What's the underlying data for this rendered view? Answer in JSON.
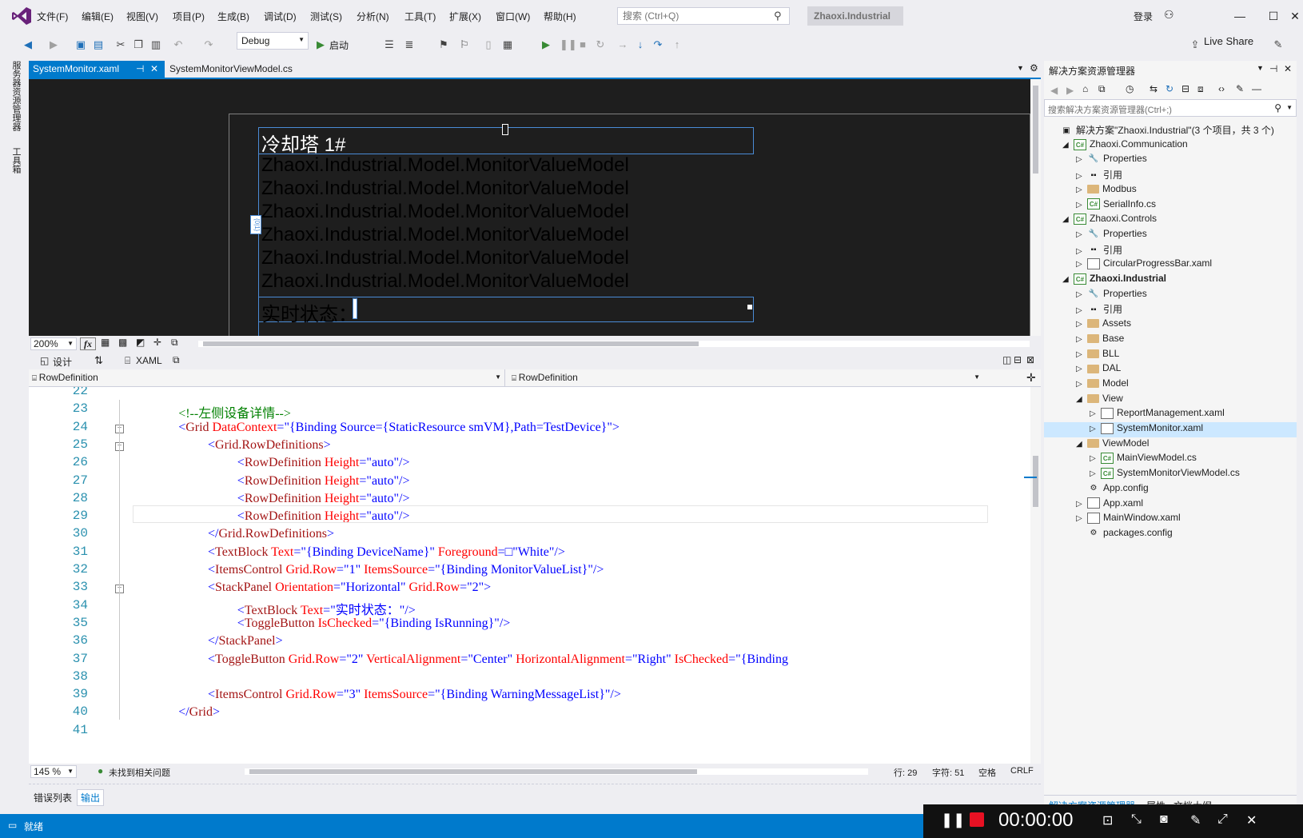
{
  "menu": [
    "文件(F)",
    "编辑(E)",
    "视图(V)",
    "项目(P)",
    "生成(B)",
    "调试(D)",
    "测试(S)",
    "分析(N)",
    "工具(T)",
    "扩展(X)",
    "窗口(W)",
    "帮助(H)"
  ],
  "search": {
    "placeholder": "搜索 (Ctrl+Q)"
  },
  "solution_badge": "Zhaoxi.Industrial",
  "login": "登录",
  "toolbar": {
    "config": "Debug",
    "start": "启动",
    "liveshare": "Live Share"
  },
  "left_tabs": [
    "服务器资源管理器",
    "工具箱"
  ],
  "tabs": [
    {
      "label": "SystemMonitor.xaml"
    },
    {
      "label": "SystemMonitorViewModel.cs"
    }
  ],
  "designer": {
    "title": "冷却塔 1#",
    "rows": [
      "Zhaoxi.Industrial.Model.MonitorValueModel",
      "Zhaoxi.Industrial.Model.MonitorValueModel",
      "Zhaoxi.Industrial.Model.MonitorValueModel",
      "Zhaoxi.Industrial.Model.MonitorValueModel",
      "Zhaoxi.Industrial.Model.MonitorValueModel",
      "Zhaoxi.Industrial.Model.MonitorValueModel"
    ],
    "status_label": "实时状态：",
    "adorner": "{0|1}",
    "zoom": "200%",
    "fx": "fx"
  },
  "split": {
    "design": "设计",
    "xaml": "XAML"
  },
  "nav": {
    "left": "RowDefinition",
    "right": "RowDefinition"
  },
  "code_lines": [
    {
      "n": "22",
      "indent": 0,
      "parts": []
    },
    {
      "n": "23",
      "indent": 6,
      "parts": [
        [
          "c",
          "<!--左侧设备详情-->"
        ]
      ]
    },
    {
      "n": "24",
      "indent": 6,
      "parts": [
        [
          "p",
          "<"
        ],
        [
          "t",
          "Grid"
        ],
        [
          "a",
          " DataContext"
        ],
        [
          "p",
          "=\""
        ],
        [
          "v",
          "{Binding Source={StaticResource smVM},Path=TestDevice}"
        ],
        [
          "p",
          "\">"
        ]
      ]
    },
    {
      "n": "25",
      "indent": 10,
      "parts": [
        [
          "p",
          "<"
        ],
        [
          "t",
          "Grid.RowDefinitions"
        ],
        [
          "p",
          ">"
        ]
      ]
    },
    {
      "n": "26",
      "indent": 14,
      "parts": [
        [
          "p",
          "<"
        ],
        [
          "t",
          "RowDefinition"
        ],
        [
          "a",
          " Height"
        ],
        [
          "p",
          "=\""
        ],
        [
          "v",
          "auto"
        ],
        [
          "p",
          "\"/>"
        ]
      ]
    },
    {
      "n": "27",
      "indent": 14,
      "parts": [
        [
          "p",
          "<"
        ],
        [
          "t",
          "RowDefinition"
        ],
        [
          "a",
          " Height"
        ],
        [
          "p",
          "=\""
        ],
        [
          "v",
          "auto"
        ],
        [
          "p",
          "\"/>"
        ]
      ]
    },
    {
      "n": "28",
      "indent": 14,
      "parts": [
        [
          "p",
          "<"
        ],
        [
          "t",
          "RowDefinition"
        ],
        [
          "a",
          " Height"
        ],
        [
          "p",
          "=\""
        ],
        [
          "v",
          "auto"
        ],
        [
          "p",
          "\"/>"
        ]
      ]
    },
    {
      "n": "29",
      "indent": 14,
      "parts": [
        [
          "p",
          "<"
        ],
        [
          "t",
          "RowDefinition"
        ],
        [
          "a",
          " Height"
        ],
        [
          "p",
          "=\""
        ],
        [
          "v",
          "auto"
        ],
        [
          "p",
          "\"/>"
        ]
      ]
    },
    {
      "n": "30",
      "indent": 10,
      "parts": [
        [
          "p",
          "</"
        ],
        [
          "t",
          "Grid.RowDefinitions"
        ],
        [
          "p",
          ">"
        ]
      ]
    },
    {
      "n": "31",
      "indent": 10,
      "parts": [
        [
          "p",
          "<"
        ],
        [
          "t",
          "TextBlock"
        ],
        [
          "a",
          " Text"
        ],
        [
          "p",
          "=\""
        ],
        [
          "v",
          "{Binding DeviceName}"
        ],
        [
          "p",
          "\""
        ],
        [
          "a",
          " Foreground"
        ],
        [
          "p",
          "=□\""
        ],
        [
          "v",
          "White"
        ],
        [
          "p",
          "\"/>"
        ]
      ]
    },
    {
      "n": "32",
      "indent": 10,
      "parts": [
        [
          "p",
          "<"
        ],
        [
          "t",
          "ItemsControl"
        ],
        [
          "a",
          " Grid.Row"
        ],
        [
          "p",
          "=\""
        ],
        [
          "v",
          "1"
        ],
        [
          "p",
          "\""
        ],
        [
          "a",
          " ItemsSource"
        ],
        [
          "p",
          "=\""
        ],
        [
          "v",
          "{Binding MonitorValueList}"
        ],
        [
          "p",
          "\"/>"
        ]
      ]
    },
    {
      "n": "33",
      "indent": 10,
      "parts": [
        [
          "p",
          "<"
        ],
        [
          "t",
          "StackPanel"
        ],
        [
          "a",
          " Orientation"
        ],
        [
          "p",
          "=\""
        ],
        [
          "v",
          "Horizontal"
        ],
        [
          "p",
          "\""
        ],
        [
          "a",
          " Grid.Row"
        ],
        [
          "p",
          "=\""
        ],
        [
          "v",
          "2"
        ],
        [
          "p",
          "\">"
        ]
      ]
    },
    {
      "n": "34",
      "indent": 14,
      "parts": [
        [
          "p",
          "<"
        ],
        [
          "t",
          "TextBlock"
        ],
        [
          "a",
          " Text"
        ],
        [
          "p",
          "=\""
        ],
        [
          "v",
          "实时状态："
        ],
        [
          "p",
          "\"/>"
        ]
      ]
    },
    {
      "n": "35",
      "indent": 14,
      "parts": [
        [
          "p",
          "<"
        ],
        [
          "t",
          "ToggleButton"
        ],
        [
          "a",
          " IsChecked"
        ],
        [
          "p",
          "=\""
        ],
        [
          "v",
          "{Binding IsRunning}"
        ],
        [
          "p",
          "\"/>"
        ]
      ]
    },
    {
      "n": "36",
      "indent": 10,
      "parts": [
        [
          "p",
          "</"
        ],
        [
          "t",
          "StackPanel"
        ],
        [
          "p",
          ">"
        ]
      ]
    },
    {
      "n": "37",
      "indent": 10,
      "parts": [
        [
          "p",
          "<"
        ],
        [
          "t",
          "ToggleButton"
        ],
        [
          "a",
          " Grid.Row"
        ],
        [
          "p",
          "=\""
        ],
        [
          "v",
          "2"
        ],
        [
          "p",
          "\""
        ],
        [
          "a",
          " VerticalAlignment"
        ],
        [
          "p",
          "=\""
        ],
        [
          "v",
          "Center"
        ],
        [
          "p",
          "\""
        ],
        [
          "a",
          " HorizontalAlignment"
        ],
        [
          "p",
          "=\""
        ],
        [
          "v",
          "Right"
        ],
        [
          "p",
          "\""
        ],
        [
          "a",
          " IsChecked"
        ],
        [
          "p",
          "=\""
        ],
        [
          "v",
          "{Binding"
        ]
      ]
    },
    {
      "n": "38",
      "indent": 0,
      "parts": []
    },
    {
      "n": "39",
      "indent": 10,
      "parts": [
        [
          "p",
          "<"
        ],
        [
          "t",
          "ItemsControl"
        ],
        [
          "a",
          " Grid.Row"
        ],
        [
          "p",
          "=\""
        ],
        [
          "v",
          "3"
        ],
        [
          "p",
          "\""
        ],
        [
          "a",
          " ItemsSource"
        ],
        [
          "p",
          "=\""
        ],
        [
          "v",
          "{Binding WarningMessageList}"
        ],
        [
          "p",
          "\"/>"
        ]
      ]
    },
    {
      "n": "40",
      "indent": 6,
      "parts": [
        [
          "p",
          "</"
        ],
        [
          "t",
          "Grid"
        ],
        [
          "p",
          ">"
        ]
      ]
    },
    {
      "n": "41",
      "indent": 0,
      "parts": []
    }
  ],
  "editor_status": {
    "zoom": "145 %",
    "issues": "未找到相关问题",
    "line": "行: 29",
    "char": "字符: 51",
    "space": "空格",
    "eol": "CRLF"
  },
  "output_tabs": [
    "错误列表",
    "输出"
  ],
  "status": "就绪",
  "solution": {
    "title": "解决方案资源管理器",
    "search": "搜索解决方案资源管理器(Ctrl+;)",
    "items": [
      {
        "label": "解决方案\"Zhaoxi.Industrial\"(3 个项目，共 3 个)",
        "lvl": 0,
        "arrow": "",
        "icon": "solution"
      },
      {
        "label": "Zhaoxi.Communication",
        "lvl": 1,
        "arrow": "◢",
        "icon": "cs"
      },
      {
        "label": "Properties",
        "lvl": 2,
        "arrow": "▷",
        "icon": "wrench"
      },
      {
        "label": "引用",
        "lvl": 2,
        "arrow": "▷",
        "icon": "ref"
      },
      {
        "label": "Modbus",
        "lvl": 2,
        "arrow": "▷",
        "icon": "folder"
      },
      {
        "label": "SerialInfo.cs",
        "lvl": 2,
        "arrow": "▷",
        "icon": "csfile"
      },
      {
        "label": "Zhaoxi.Controls",
        "lvl": 1,
        "arrow": "◢",
        "icon": "cs"
      },
      {
        "label": "Properties",
        "lvl": 2,
        "arrow": "▷",
        "icon": "wrench"
      },
      {
        "label": "引用",
        "lvl": 2,
        "arrow": "▷",
        "icon": "ref"
      },
      {
        "label": "CircularProgressBar.xaml",
        "lvl": 2,
        "arrow": "▷",
        "icon": "xaml"
      },
      {
        "label": "Zhaoxi.Industrial",
        "lvl": 1,
        "arrow": "◢",
        "icon": "cs",
        "bold": true
      },
      {
        "label": "Properties",
        "lvl": 2,
        "arrow": "▷",
        "icon": "wrench"
      },
      {
        "label": "引用",
        "lvl": 2,
        "arrow": "▷",
        "icon": "ref"
      },
      {
        "label": "Assets",
        "lvl": 2,
        "arrow": "▷",
        "icon": "folder"
      },
      {
        "label": "Base",
        "lvl": 2,
        "arrow": "▷",
        "icon": "folder"
      },
      {
        "label": "BLL",
        "lvl": 2,
        "arrow": "▷",
        "icon": "folder"
      },
      {
        "label": "DAL",
        "lvl": 2,
        "arrow": "▷",
        "icon": "folder"
      },
      {
        "label": "Model",
        "lvl": 2,
        "arrow": "▷",
        "icon": "folder"
      },
      {
        "label": "View",
        "lvl": 2,
        "arrow": "◢",
        "icon": "folder-open"
      },
      {
        "label": "ReportManagement.xaml",
        "lvl": 3,
        "arrow": "▷",
        "icon": "xaml"
      },
      {
        "label": "SystemMonitor.xaml",
        "lvl": 3,
        "arrow": "▷",
        "icon": "xaml",
        "selected": true
      },
      {
        "label": "ViewModel",
        "lvl": 2,
        "arrow": "◢",
        "icon": "folder-open"
      },
      {
        "label": "MainViewModel.cs",
        "lvl": 3,
        "arrow": "▷",
        "icon": "csfile"
      },
      {
        "label": "SystemMonitorViewModel.cs",
        "lvl": 3,
        "arrow": "▷",
        "icon": "csfile"
      },
      {
        "label": "App.config",
        "lvl": 2,
        "arrow": "",
        "icon": "config"
      },
      {
        "label": "App.xaml",
        "lvl": 2,
        "arrow": "▷",
        "icon": "xaml"
      },
      {
        "label": "MainWindow.xaml",
        "lvl": 2,
        "arrow": "▷",
        "icon": "xaml"
      },
      {
        "label": "packages.config",
        "lvl": 2,
        "arrow": "",
        "icon": "config"
      }
    ],
    "bottom_tabs": [
      "解决方案资源管理器",
      "属性",
      "文档大纲"
    ]
  },
  "recorder": {
    "time": "00:00:00"
  }
}
